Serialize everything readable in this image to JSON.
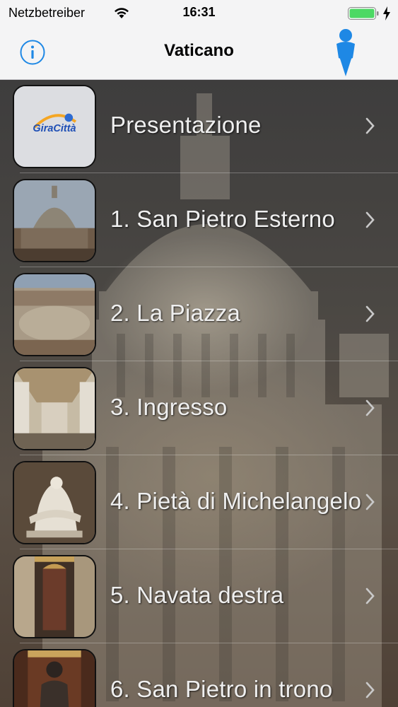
{
  "status_bar": {
    "carrier": "Netzbetreiber",
    "time": "16:31"
  },
  "nav": {
    "title": "Vaticano",
    "info_icon": "info-icon",
    "location_icon": "location-pin-icon",
    "accent_color": "#1e88e5"
  },
  "list": {
    "items": [
      {
        "label": "Presentazione",
        "thumb": "giracitta-logo"
      },
      {
        "label": "1. San Pietro Esterno",
        "thumb": "basilica-dome-photo"
      },
      {
        "label": "2. La Piazza",
        "thumb": "piazza-photo"
      },
      {
        "label": "3. Ingresso",
        "thumb": "ingresso-photo"
      },
      {
        "label": "4. Pietà di Michelangelo",
        "thumb": "pieta-photo"
      },
      {
        "label": "5. Navata destra",
        "thumb": "navata-photo"
      },
      {
        "label": "6. San Pietro in trono",
        "thumb": "statue-photo"
      }
    ],
    "logo_text": "GiraCittà"
  }
}
